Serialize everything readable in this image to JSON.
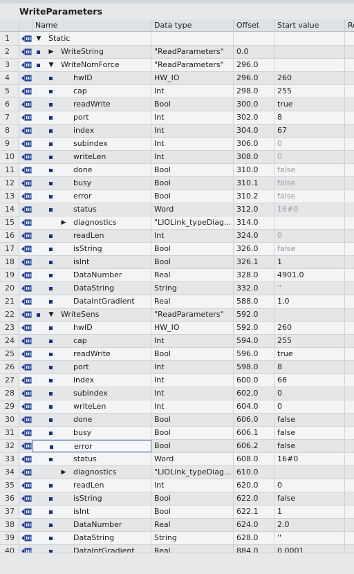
{
  "window": {
    "title": "WriteParameters"
  },
  "columns": {
    "name": "Name",
    "data_type": "Data type",
    "offset": "Offset",
    "start_value": "Start value",
    "retain": "Re"
  },
  "colors": {
    "blue_square": "#1b2f8f",
    "focus_border": "#4a73b3",
    "gray_text": "#9a9da1"
  },
  "rows": [
    {
      "num": "1",
      "name": "Static",
      "type": "",
      "offset": "",
      "start": "",
      "level": 0,
      "expand": "open",
      "sq": false,
      "gray": false
    },
    {
      "num": "2",
      "name": "WriteString",
      "type": "\"ReadParameters\"",
      "offset": "0.0",
      "start": "",
      "level": 1,
      "expand": "closed",
      "sq": true,
      "gray": false
    },
    {
      "num": "3",
      "name": "WriteNomForce",
      "type": "\"ReadParameters\"",
      "offset": "296.0",
      "start": "",
      "level": 1,
      "expand": "open",
      "sq": true,
      "gray": false
    },
    {
      "num": "4",
      "name": "hwID",
      "type": "HW_IO",
      "offset": "296.0",
      "start": "260",
      "level": 2,
      "expand": "none",
      "sq": true,
      "gray": false
    },
    {
      "num": "5",
      "name": "cap",
      "type": "Int",
      "offset": "298.0",
      "start": "255",
      "level": 2,
      "expand": "none",
      "sq": true,
      "gray": false
    },
    {
      "num": "6",
      "name": "readWrite",
      "type": "Bool",
      "offset": "300.0",
      "start": "true",
      "level": 2,
      "expand": "none",
      "sq": true,
      "gray": false
    },
    {
      "num": "7",
      "name": "port",
      "type": "Int",
      "offset": "302.0",
      "start": "8",
      "level": 2,
      "expand": "none",
      "sq": true,
      "gray": false
    },
    {
      "num": "8",
      "name": "index",
      "type": "Int",
      "offset": "304.0",
      "start": "67",
      "level": 2,
      "expand": "none",
      "sq": true,
      "gray": false
    },
    {
      "num": "9",
      "name": "subindex",
      "type": "Int",
      "offset": "306.0",
      "start": "0",
      "level": 2,
      "expand": "none",
      "sq": true,
      "gray": true
    },
    {
      "num": "10",
      "name": "writeLen",
      "type": "Int",
      "offset": "308.0",
      "start": "0",
      "level": 2,
      "expand": "none",
      "sq": true,
      "gray": true
    },
    {
      "num": "11",
      "name": "done",
      "type": "Bool",
      "offset": "310.0",
      "start": "false",
      "level": 2,
      "expand": "none",
      "sq": true,
      "gray": true
    },
    {
      "num": "12",
      "name": "busy",
      "type": "Bool",
      "offset": "310.1",
      "start": "false",
      "level": 2,
      "expand": "none",
      "sq": true,
      "gray": true
    },
    {
      "num": "13",
      "name": "error",
      "type": "Bool",
      "offset": "310.2",
      "start": "false",
      "level": 2,
      "expand": "none",
      "sq": true,
      "gray": true
    },
    {
      "num": "14",
      "name": "status",
      "type": "Word",
      "offset": "312.0",
      "start": "16#0",
      "level": 2,
      "expand": "none",
      "sq": true,
      "gray": true
    },
    {
      "num": "15",
      "name": "diagnostics",
      "type": "\"LIOLink_typeDiag...",
      "offset": "314.0",
      "start": "",
      "level": 2,
      "expand": "closed",
      "sq": false,
      "gray": false
    },
    {
      "num": "16",
      "name": "readLen",
      "type": "Int",
      "offset": "324.0",
      "start": "0",
      "level": 2,
      "expand": "none",
      "sq": true,
      "gray": true
    },
    {
      "num": "17",
      "name": "isString",
      "type": "Bool",
      "offset": "326.0",
      "start": "false",
      "level": 2,
      "expand": "none",
      "sq": true,
      "gray": true
    },
    {
      "num": "18",
      "name": "isInt",
      "type": "Bool",
      "offset": "326.1",
      "start": "1",
      "level": 2,
      "expand": "none",
      "sq": true,
      "gray": false
    },
    {
      "num": "19",
      "name": "DataNumber",
      "type": "Real",
      "offset": "328.0",
      "start": "4901.0",
      "level": 2,
      "expand": "none",
      "sq": true,
      "gray": false
    },
    {
      "num": "20",
      "name": "DataString",
      "type": "String",
      "offset": "332.0",
      "start": "''",
      "level": 2,
      "expand": "none",
      "sq": true,
      "gray": true
    },
    {
      "num": "21",
      "name": "DataIntGradient",
      "type": "Real",
      "offset": "588.0",
      "start": "1.0",
      "level": 2,
      "expand": "none",
      "sq": true,
      "gray": false
    },
    {
      "num": "22",
      "name": "WriteSens",
      "type": "\"ReadParameters\"",
      "offset": "592.0",
      "start": "",
      "level": 1,
      "expand": "open",
      "sq": true,
      "gray": false
    },
    {
      "num": "23",
      "name": "hwID",
      "type": "HW_IO",
      "offset": "592.0",
      "start": "260",
      "level": 2,
      "expand": "none",
      "sq": true,
      "gray": false
    },
    {
      "num": "24",
      "name": "cap",
      "type": "Int",
      "offset": "594.0",
      "start": "255",
      "level": 2,
      "expand": "none",
      "sq": true,
      "gray": false
    },
    {
      "num": "25",
      "name": "readWrite",
      "type": "Bool",
      "offset": "596.0",
      "start": "true",
      "level": 2,
      "expand": "none",
      "sq": true,
      "gray": false
    },
    {
      "num": "26",
      "name": "port",
      "type": "Int",
      "offset": "598.0",
      "start": "8",
      "level": 2,
      "expand": "none",
      "sq": true,
      "gray": false
    },
    {
      "num": "27",
      "name": "index",
      "type": "Int",
      "offset": "600.0",
      "start": "66",
      "level": 2,
      "expand": "none",
      "sq": true,
      "gray": false
    },
    {
      "num": "28",
      "name": "subindex",
      "type": "Int",
      "offset": "602.0",
      "start": "0",
      "level": 2,
      "expand": "none",
      "sq": true,
      "gray": false
    },
    {
      "num": "29",
      "name": "writeLen",
      "type": "Int",
      "offset": "604.0",
      "start": "0",
      "level": 2,
      "expand": "none",
      "sq": true,
      "gray": false
    },
    {
      "num": "30",
      "name": "done",
      "type": "Bool",
      "offset": "606.0",
      "start": "false",
      "level": 2,
      "expand": "none",
      "sq": true,
      "gray": false
    },
    {
      "num": "31",
      "name": "busy",
      "type": "Bool",
      "offset": "606.1",
      "start": "false",
      "level": 2,
      "expand": "none",
      "sq": true,
      "gray": false
    },
    {
      "num": "32",
      "name": "error",
      "type": "Bool",
      "offset": "606.2",
      "start": "false",
      "level": 2,
      "expand": "none",
      "sq": true,
      "gray": false,
      "focused": true
    },
    {
      "num": "33",
      "name": "status",
      "type": "Word",
      "offset": "608.0",
      "start": "16#0",
      "level": 2,
      "expand": "none",
      "sq": true,
      "gray": false
    },
    {
      "num": "34",
      "name": "diagnostics",
      "type": "\"LIOLink_typeDiag...",
      "offset": "610.0",
      "start": "",
      "level": 2,
      "expand": "closed",
      "sq": false,
      "gray": false
    },
    {
      "num": "35",
      "name": "readLen",
      "type": "Int",
      "offset": "620.0",
      "start": "0",
      "level": 2,
      "expand": "none",
      "sq": true,
      "gray": false
    },
    {
      "num": "36",
      "name": "isString",
      "type": "Bool",
      "offset": "622.0",
      "start": "false",
      "level": 2,
      "expand": "none",
      "sq": true,
      "gray": false
    },
    {
      "num": "37",
      "name": "isInt",
      "type": "Bool",
      "offset": "622.1",
      "start": "1",
      "level": 2,
      "expand": "none",
      "sq": true,
      "gray": false
    },
    {
      "num": "38",
      "name": "DataNumber",
      "type": "Real",
      "offset": "624.0",
      "start": "2.0",
      "level": 2,
      "expand": "none",
      "sq": true,
      "gray": false
    },
    {
      "num": "39",
      "name": "DataString",
      "type": "String",
      "offset": "628.0",
      "start": "''",
      "level": 2,
      "expand": "none",
      "sq": true,
      "gray": false
    },
    {
      "num": "40",
      "name": "DataIntGradient",
      "type": "Real",
      "offset": "884.0",
      "start": "0.0001",
      "level": 2,
      "expand": "none",
      "sq": true,
      "gray": false
    }
  ]
}
